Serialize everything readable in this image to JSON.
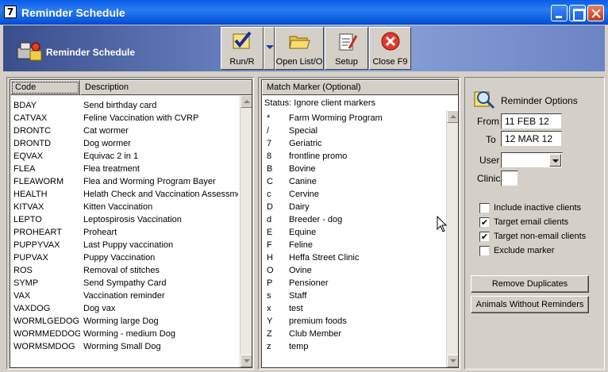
{
  "window": {
    "title": "Reminder Schedule"
  },
  "header": {
    "title": "Reminder Schedule"
  },
  "toolbar": {
    "run_label": "Run/R",
    "open_label": "Open List/O",
    "setup_label": "Setup",
    "close_label": "Close F9"
  },
  "codes": {
    "headers": {
      "code": "Code",
      "description": "Description"
    },
    "rows": [
      {
        "code": "BDAY",
        "description": "Send birthday card"
      },
      {
        "code": "CATVAX",
        "description": "Feline Vaccination with CVRP"
      },
      {
        "code": "DRONTC",
        "description": "Cat wormer"
      },
      {
        "code": "DRONTD",
        "description": "Dog wormer"
      },
      {
        "code": "EQVAX",
        "description": "Equivac 2 in 1"
      },
      {
        "code": "FLEA",
        "description": "Flea treatment"
      },
      {
        "code": "FLEAWORM",
        "description": "Flea and Worming Program Bayer"
      },
      {
        "code": "HEALTH",
        "description": "Helath Check and Vaccination Assessme"
      },
      {
        "code": "KITVAX",
        "description": "Kitten Vaccination"
      },
      {
        "code": "LEPTO",
        "description": "Leptospirosis Vaccination"
      },
      {
        "code": "PROHEART",
        "description": "Proheart"
      },
      {
        "code": "PUPPYVAX",
        "description": "Last Puppy vaccination"
      },
      {
        "code": "PUPVAX",
        "description": "Puppy Vaccination"
      },
      {
        "code": "ROS",
        "description": "Removal of stitches"
      },
      {
        "code": "SYMP",
        "description": "Send Sympathy Card"
      },
      {
        "code": "VAX",
        "description": "Vaccination reminder"
      },
      {
        "code": "VAXDOG",
        "description": "Dog vax"
      },
      {
        "code": "WORMLGEDOG",
        "description": "Worming large Dog"
      },
      {
        "code": "WORMMEDDOG",
        "description": "Worming  - medium Dog"
      },
      {
        "code": "WORMSMDOG",
        "description": "Worming Small Dog"
      }
    ]
  },
  "markers": {
    "header": "Match Marker (Optional)",
    "status": "Status: Ignore client markers",
    "rows": [
      {
        "key": "*",
        "label": "Farm Worming Program"
      },
      {
        "key": "/",
        "label": "Special"
      },
      {
        "key": "7",
        "label": "Geriatric"
      },
      {
        "key": "8",
        "label": "frontline promo"
      },
      {
        "key": "B",
        "label": "Bovine"
      },
      {
        "key": "C",
        "label": "Canine"
      },
      {
        "key": "c",
        "label": "Cervine"
      },
      {
        "key": "D",
        "label": "Dairy"
      },
      {
        "key": "d",
        "label": "Breeder - dog"
      },
      {
        "key": "E",
        "label": "Equine"
      },
      {
        "key": "F",
        "label": "Feline"
      },
      {
        "key": "H",
        "label": "Heffa Street Clinic"
      },
      {
        "key": "O",
        "label": "Ovine"
      },
      {
        "key": "P",
        "label": "Pensioner"
      },
      {
        "key": "s",
        "label": "Staff"
      },
      {
        "key": "x",
        "label": "test"
      },
      {
        "key": "Y",
        "label": "premium foods"
      },
      {
        "key": "Z",
        "label": "Club Member"
      },
      {
        "key": "z",
        "label": "temp"
      }
    ]
  },
  "options": {
    "title": "Reminder Options",
    "from_label": "From",
    "from_value": "11 FEB 12",
    "to_label": "To",
    "to_value": "12 MAR 12",
    "user_label": "User",
    "user_value": "",
    "clinic_label": "Clinic",
    "clinic_value": "",
    "checkboxes": [
      {
        "label": "Include inactive clients",
        "checked": false
      },
      {
        "label": "Target email clients",
        "checked": true
      },
      {
        "label": "Target non-email clients",
        "checked": true
      },
      {
        "label": "Exclude marker",
        "checked": false
      }
    ],
    "remove_duplicates_label": "Remove Duplicates",
    "animals_without_label": "Animals Without Reminders"
  }
}
